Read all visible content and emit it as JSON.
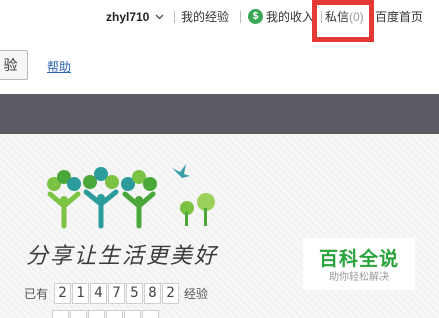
{
  "topbar": {
    "username": "zhyl710",
    "my_experience": "我的经验",
    "coin_symbol": "$",
    "my_income": "我的收入",
    "private_message": "私信",
    "message_count": "(0)",
    "baidu_home": "百度首页"
  },
  "search": {
    "button_label": "验"
  },
  "help_link": "帮助",
  "banner": {
    "slogan": "分享让生活更美好",
    "count_prefix": "已有",
    "digits": [
      "2",
      "1",
      "4",
      "7",
      "5",
      "8",
      "2"
    ],
    "count_suffix": "经验"
  },
  "badge": {
    "title": "百科全说",
    "subtitle": "助你轻松解决"
  },
  "colors": {
    "highlight": "#e53935",
    "navbar": "#5b5b63",
    "badge_green": "#27a33a",
    "link_blue": "#2d64b3"
  }
}
